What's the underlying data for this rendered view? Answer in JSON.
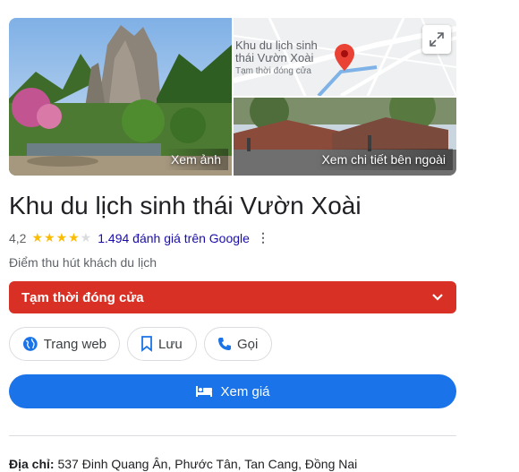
{
  "media": {
    "photos_label": "Xem ảnh",
    "street_view_label": "Xem chi tiết bên ngoài",
    "map": {
      "place_name_line1": "Khu du lịch sinh",
      "place_name_line2": "thái Vườn Xoài",
      "status": "Tạm thời đóng cửa",
      "pin_icon": "map-pin-icon",
      "expand_icon": "expand-icon"
    }
  },
  "place": {
    "title": "Khu du lịch sinh thái Vườn Xoài",
    "rating": "4,2",
    "rating_value": 4.2,
    "rating_max": 5,
    "reviews_text": "1.494 đánh giá trên Google",
    "more_icon": "⋮",
    "category": "Điểm thu hút khách du lịch"
  },
  "status_bar": {
    "label": "Tạm thời đóng cửa",
    "color": "#d93025",
    "icon": "chevron-down-icon"
  },
  "actions": {
    "website_label": "Trang web",
    "save_label": "Lưu",
    "call_label": "Gọi",
    "accent": "#1a73e8"
  },
  "price_button": {
    "label": "Xem giá",
    "icon": "bed-icon",
    "color": "#1a73e8"
  },
  "address": {
    "label": "Địa chỉ:",
    "value": "537 Đinh Quang Ân, Phước Tân, Tan Cang, Đồng Nai"
  }
}
